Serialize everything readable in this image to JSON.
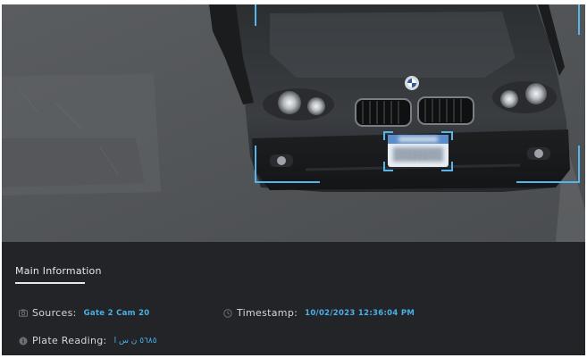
{
  "camera": {
    "brand_emblem": "bmw-roundel",
    "plate_text": "١٢٣٤"
  },
  "info": {
    "section_title": "Main Information",
    "source": {
      "icon": "camera-icon",
      "label": "Sources:",
      "value": "Gate 2 Cam 20"
    },
    "timestamp": {
      "icon": "clock-icon",
      "label": "Timestamp:",
      "value": "10/02/2023 12:36:04 PM"
    },
    "plate_reading": {
      "icon": "info-circle-icon",
      "label": "Plate Reading:",
      "value": "٥٦٨٥ ن س ا"
    }
  },
  "colors": {
    "accent": "#4ab0e8",
    "panel": "#232428",
    "bracket": "#56b6ec"
  }
}
